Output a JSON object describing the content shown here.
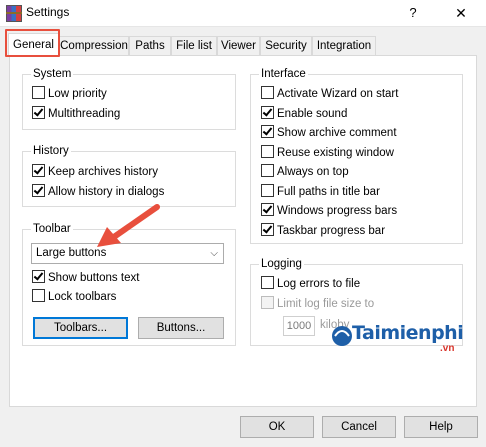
{
  "window": {
    "title": "Settings",
    "help": "?",
    "close": "✕"
  },
  "tabs": [
    {
      "label": "General"
    },
    {
      "label": "Compression"
    },
    {
      "label": "Paths"
    },
    {
      "label": "File list"
    },
    {
      "label": "Viewer"
    },
    {
      "label": "Security"
    },
    {
      "label": "Integration"
    }
  ],
  "system": {
    "title": "System",
    "items": [
      {
        "label": "Low priority",
        "checked": false
      },
      {
        "label": "Multithreading",
        "checked": true
      }
    ]
  },
  "history": {
    "title": "History",
    "items": [
      {
        "label": "Keep archives history",
        "checked": true
      },
      {
        "label": "Allow history in dialogs",
        "checked": true
      }
    ]
  },
  "toolbar": {
    "title": "Toolbar",
    "select_value": "Large buttons",
    "items": [
      {
        "label": "Show buttons text",
        "checked": true
      },
      {
        "label": "Lock toolbars",
        "checked": false
      }
    ],
    "toolbars_button": "Toolbars...",
    "buttons_button": "Buttons..."
  },
  "interface": {
    "title": "Interface",
    "items": [
      {
        "label": "Activate Wizard on start",
        "checked": false
      },
      {
        "label": "Enable sound",
        "checked": true
      },
      {
        "label": "Show archive comment",
        "checked": true
      },
      {
        "label": "Reuse existing window",
        "checked": false
      },
      {
        "label": "Always on top",
        "checked": false
      },
      {
        "label": "Full paths in title bar",
        "checked": false
      },
      {
        "label": "Windows progress bars",
        "checked": true
      },
      {
        "label": "Taskbar progress bar",
        "checked": true
      }
    ]
  },
  "logging": {
    "title": "Logging",
    "items": [
      {
        "label": "Log errors to file",
        "checked": false
      },
      {
        "label": "Limit log file size to",
        "checked": false,
        "disabled": true
      }
    ],
    "size_value": "1000",
    "size_unit": "kiloby"
  },
  "dialog_buttons": {
    "ok": "OK",
    "cancel": "Cancel",
    "help": "Help"
  },
  "watermark": {
    "brand": "Taimienphi",
    "suffix": ".vn"
  },
  "colors": {
    "highlight": "#e84f3d",
    "focus": "#0078d7"
  }
}
